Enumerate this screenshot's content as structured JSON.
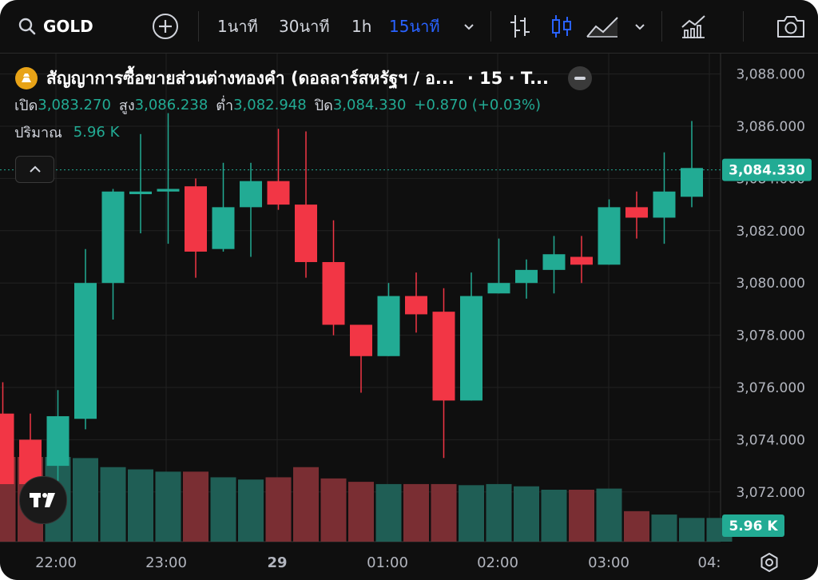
{
  "toolbar": {
    "symbol": "GOLD",
    "intervals": [
      "1นาที",
      "30นาที",
      "1h",
      "15นาที"
    ],
    "active_interval": "15นาที"
  },
  "legend": {
    "title": "สัญญาการซื้อขายส่วนต่างทองคำ (ดอลลาร์สหรัฐฯ / อ...",
    "interval": "· 15 · T...",
    "ohlc": {
      "open_label": "เปิด",
      "open": "3,083.270",
      "high_label": "สูง",
      "high": "3,086.238",
      "low_label": "ต่ำ",
      "low": "3,082.948",
      "close_label": "ปิด",
      "close": "3,084.330",
      "change": "+0.870 (+0.03%)"
    },
    "volume_label": "ปริมาณ",
    "volume": "5.96 K"
  },
  "colors": {
    "up": "#22ab94",
    "down": "#f23645",
    "background": "#0f0f0f",
    "accent": "#2962ff"
  },
  "chart_data": {
    "type": "candlestick",
    "price_axis_ticks": [
      "3,088.000",
      "3,086.000",
      "3,084.000",
      "3,082.000",
      "3,080.000",
      "3,078.000",
      "3,076.000",
      "3,074.000",
      "3,072.000"
    ],
    "price_ticks": [
      3088,
      3086,
      3084,
      3082,
      3080,
      3078,
      3076,
      3074,
      3072
    ],
    "time_labels": [
      "22:00",
      "23:00",
      "29",
      "01:00",
      "02:00",
      "03:00",
      "04:"
    ],
    "last_price_label": "3,084.330",
    "last_price": 3084.33,
    "volume_label": "5.96 K",
    "candles": [
      {
        "o": 3075.0,
        "h": 3076.2,
        "l": 3072.3,
        "c": 3072.3
      },
      {
        "o": 3074.0,
        "h": 3075.0,
        "l": 3072.3,
        "c": 3072.3
      },
      {
        "o": 3073.0,
        "h": 3075.9,
        "l": 3072.3,
        "c": 3074.9
      },
      {
        "o": 3074.8,
        "h": 3081.3,
        "l": 3074.4,
        "c": 3080.0
      },
      {
        "o": 3080.0,
        "h": 3083.6,
        "l": 3078.6,
        "c": 3083.5
      },
      {
        "o": 3083.4,
        "h": 3085.7,
        "l": 3081.9,
        "c": 3083.5
      },
      {
        "o": 3083.5,
        "h": 3086.5,
        "l": 3081.5,
        "c": 3083.6
      },
      {
        "o": 3083.7,
        "h": 3084.0,
        "l": 3080.2,
        "c": 3081.2
      },
      {
        "o": 3081.3,
        "h": 3084.6,
        "l": 3081.2,
        "c": 3082.9
      },
      {
        "o": 3082.9,
        "h": 3084.6,
        "l": 3081.0,
        "c": 3083.9
      },
      {
        "o": 3083.9,
        "h": 3085.9,
        "l": 3082.8,
        "c": 3083.0
      },
      {
        "o": 3083.0,
        "h": 3085.8,
        "l": 3080.2,
        "c": 3080.8
      },
      {
        "o": 3080.8,
        "h": 3082.4,
        "l": 3078.0,
        "c": 3078.4
      },
      {
        "o": 3078.4,
        "h": 3078.4,
        "l": 3075.8,
        "c": 3077.2
      },
      {
        "o": 3077.2,
        "h": 3080.0,
        "l": 3077.2,
        "c": 3079.5
      },
      {
        "o": 3079.5,
        "h": 3080.4,
        "l": 3078.1,
        "c": 3078.8
      },
      {
        "o": 3078.9,
        "h": 3079.8,
        "l": 3073.3,
        "c": 3075.5
      },
      {
        "o": 3075.5,
        "h": 3080.4,
        "l": 3075.5,
        "c": 3079.5
      },
      {
        "o": 3079.6,
        "h": 3081.7,
        "l": 3079.6,
        "c": 3080.0
      },
      {
        "o": 3080.0,
        "h": 3080.9,
        "l": 3079.4,
        "c": 3080.5
      },
      {
        "o": 3080.5,
        "h": 3081.8,
        "l": 3079.6,
        "c": 3081.1
      },
      {
        "o": 3081.0,
        "h": 3081.8,
        "l": 3080.0,
        "c": 3080.7
      },
      {
        "o": 3080.7,
        "h": 3083.2,
        "l": 3080.7,
        "c": 3082.9
      },
      {
        "o": 3082.9,
        "h": 3083.5,
        "l": 3081.7,
        "c": 3082.5
      },
      {
        "o": 3082.5,
        "h": 3085.0,
        "l": 3081.5,
        "c": 3083.5
      },
      {
        "o": 3083.3,
        "h": 3086.2,
        "l": 3082.9,
        "c": 3084.4
      }
    ],
    "volumes": [
      7.5,
      7.5,
      7.5,
      7.4,
      6.6,
      6.4,
      6.2,
      6.2,
      5.7,
      5.5,
      5.7,
      6.6,
      5.6,
      5.3,
      5.1,
      5.1,
      5.1,
      5.0,
      5.1,
      4.9,
      4.6,
      4.6,
      4.7,
      2.7,
      2.4,
      2.1,
      2.1
    ]
  }
}
